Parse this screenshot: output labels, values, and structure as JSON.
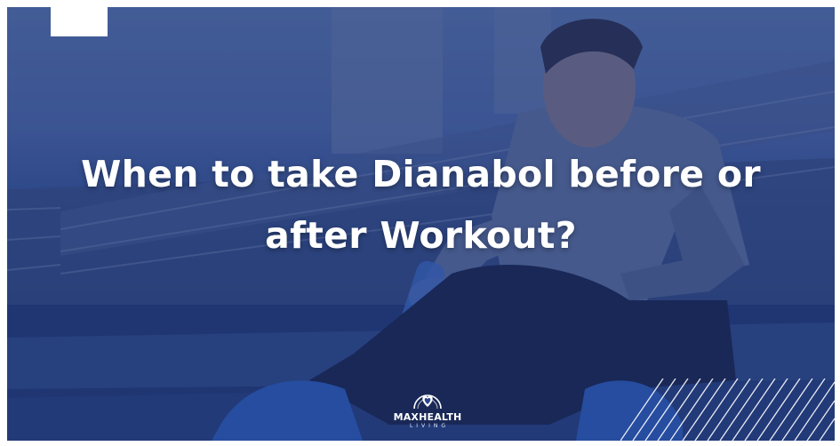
{
  "headline": {
    "line1": "When to take Dianabol before or",
    "line2": "after Workout?"
  },
  "logo": {
    "name": "MAXHEALTH",
    "sub": "LIVING",
    "emblem_icon": "heart-in-arch-icon"
  },
  "colors": {
    "overlay_blue": "#2b4a96",
    "text": "#ffffff",
    "corner_square": "#ffffff"
  }
}
